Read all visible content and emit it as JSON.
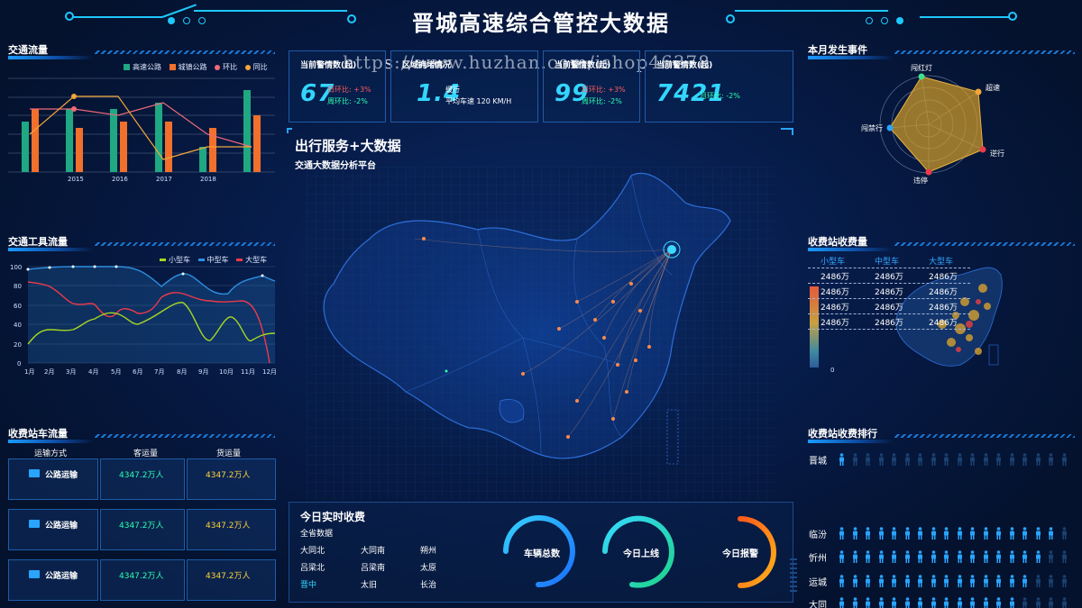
{
  "header": {
    "title": "晋城高速综合管控大数据"
  },
  "watermark": "https://www.huzhan.com/ishop46378",
  "traffic_flow": {
    "title": "交通流量",
    "legend": [
      {
        "name": "高速公路",
        "color": "#1fa882",
        "kind": "bar"
      },
      {
        "name": "城镇公路",
        "color": "#f0702c",
        "kind": "bar"
      },
      {
        "name": "环比",
        "color": "#f06a7a",
        "kind": "line"
      },
      {
        "name": "同比",
        "color": "#f3a63a",
        "kind": "line"
      }
    ],
    "years": [
      "2015",
      "2016",
      "2017",
      "2018"
    ]
  },
  "vehicle_flow": {
    "title": "交通工具流量",
    "legend": [
      {
        "name": "小型车",
        "color": "#a6d622"
      },
      {
        "name": "中型车",
        "color": "#2c8fe0"
      },
      {
        "name": "大型车",
        "color": "#ec3a4a"
      }
    ],
    "yticks": [
      "100",
      "80",
      "60",
      "40",
      "20",
      "0"
    ],
    "months": [
      "1月",
      "2月",
      "3月",
      "4月",
      "5月",
      "6月",
      "7月",
      "8月",
      "9月",
      "10月",
      "11月",
      "12月"
    ]
  },
  "toll_flow": {
    "title": "收费站车流量",
    "headers": [
      "运输方式",
      "客运量",
      "货运量"
    ],
    "rows": [
      {
        "mode": "公路运输",
        "passenger": "4347.2万人",
        "cargo": "4347.2万人"
      },
      {
        "mode": "公路运输",
        "passenger": "4347.2万人",
        "cargo": "4347.2万人"
      },
      {
        "mode": "公路运输",
        "passenger": "4347.2万人",
        "cargo": "4347.2万人"
      }
    ]
  },
  "kpis": [
    {
      "label": "当前警情数(起)",
      "value": "67",
      "ring1": "日环比: +3%",
      "ring2": "周环比: -2%"
    },
    {
      "label": "区域拥堵情况",
      "value": "1.4",
      "sub1": "缓行",
      "sub2": "平均车速 120  KM/H"
    },
    {
      "label": "当前警情数(起)",
      "value": "99",
      "ring1": "日环比: +3%",
      "ring2": "周环比: -2%"
    },
    {
      "label": "当前警情数(起)",
      "value": "7421",
      "ring1": "月环比: -2%"
    }
  ],
  "map": {
    "title": "出行服务+大数据",
    "subtitle": "交通大数据分析平台"
  },
  "realtime": {
    "title": "今日实时收费",
    "subtitle": "全省数据",
    "cities": [
      [
        "大同北",
        "大同南",
        "朔州"
      ],
      [
        "吕梁北",
        "吕梁南",
        "太原"
      ],
      [
        "晋中",
        "太旧",
        "长治"
      ]
    ],
    "rings": [
      {
        "label": "车辆总数",
        "from": "#1a6fff",
        "to": "#35d0ff"
      },
      {
        "label": "今日上线",
        "from": "#1fd48a",
        "to": "#35d8ff"
      },
      {
        "label": "今日报警",
        "from": "#ff5a1a",
        "to": "#ffb21a"
      }
    ]
  },
  "events": {
    "title": "本月发生事件",
    "axes": [
      "闯红灯",
      "超速",
      "逆行",
      "违停",
      "闯禁行"
    ],
    "axis_colors": [
      "#3ee08a",
      "#f3a63a",
      "#ec3a4a",
      "#ec3a4a",
      "#29a4ff"
    ]
  },
  "toll_fee": {
    "title": "收费站收费量",
    "headers": [
      "小型车",
      "中型车",
      "大型车"
    ],
    "rows": [
      [
        "2486万",
        "2486万",
        "2486万"
      ],
      [
        "2486万",
        "2486万",
        "2486万"
      ],
      [
        "2486万",
        "2486万",
        "2486万"
      ],
      [
        "2486万",
        "2486万",
        "2486万"
      ]
    ],
    "scale_min": "0"
  },
  "toll_rank": {
    "title": "收费站收费排行",
    "stations": [
      {
        "name": "晋城",
        "filled": 1
      },
      {
        "name": "临汾",
        "filled": 17
      },
      {
        "name": "忻州",
        "filled": 16
      },
      {
        "name": "运城",
        "filled": 15
      },
      {
        "name": "大同",
        "filled": 14
      }
    ]
  }
}
